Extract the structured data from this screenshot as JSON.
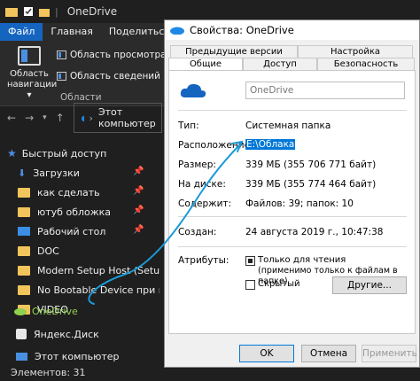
{
  "explorer": {
    "title": "OneDrive",
    "tabs": [
      "Файл",
      "Главная",
      "Поделиться"
    ],
    "ribbon": {
      "nav_pane_label_1": "Область",
      "nav_pane_label_2": "навигации",
      "preview_pane": "Область просмотра",
      "details_pane": "Область сведений",
      "group_label": "Области"
    },
    "address": "Этот компьютер",
    "nav": {
      "quick_access": "Быстрый доступ",
      "items": [
        {
          "label": "Загрузки",
          "pinned": true
        },
        {
          "label": "как сделать",
          "pinned": true
        },
        {
          "label": "ютуб обложка",
          "pinned": true
        },
        {
          "label": "Рабочий стол",
          "pinned": true
        },
        {
          "label": "DOC",
          "pinned": false
        },
        {
          "label": "Modern Setup Host (SetupHo",
          "pinned": false
        },
        {
          "label": "No Bootable Device при вкл",
          "pinned": false
        },
        {
          "label": "VIDEO",
          "pinned": false
        }
      ],
      "onedrive": "OneDrive",
      "yandex": "Яндекс.Диск",
      "this_pc": "Этот компьютер"
    },
    "status": "Элементов: 31"
  },
  "dialog": {
    "title": "Свойства: OneDrive",
    "tabs_top": [
      "Предыдущие версии",
      "Настройка"
    ],
    "tabs_bottom": [
      "Общие",
      "Доступ",
      "Безопасность"
    ],
    "name_value": "OneDrive",
    "rows": {
      "type_label": "Тип:",
      "type_value": "Системная папка",
      "location_label": "Расположение:",
      "location_value": "E:\\Облака",
      "size_label": "Размер:",
      "size_value": "339 МБ (355 706 771 байт)",
      "disk_label": "На диске:",
      "disk_value": "339 МБ (355 774 464 байт)",
      "contains_label": "Содержит:",
      "contains_value": "Файлов: 39; папок: 10",
      "created_label": "Создан:",
      "created_value": "24 августа 2019 г., 10:47:38",
      "attributes_label": "Атрибуты:"
    },
    "readonly_line1": "Только для чтения",
    "readonly_line2": "(применимо только к файлам в папке)",
    "hidden": "Скрытый",
    "other_button": "Другие...",
    "ok": "OK",
    "cancel": "Отмена",
    "apply": "Применить"
  },
  "colors": {
    "explorer_bg": "#1f1f1f",
    "accent": "#0078d7",
    "annotation": "#1a9ad6"
  }
}
